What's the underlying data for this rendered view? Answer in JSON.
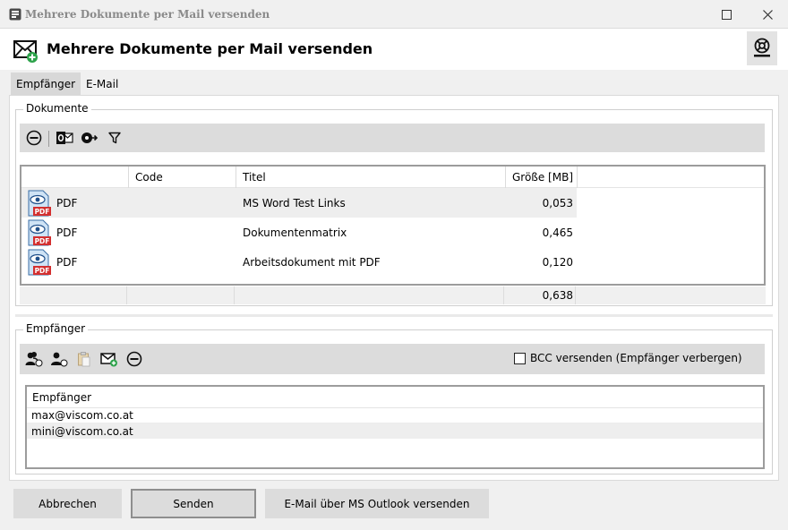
{
  "window": {
    "title": "Mehrere Dokumente per Mail versenden"
  },
  "header": {
    "title": "Mehrere Dokumente per Mail versenden"
  },
  "tabs": [
    {
      "label": "Empfänger",
      "active": true
    },
    {
      "label": "E-Mail",
      "active": false
    }
  ],
  "documents": {
    "legend": "Dokumente",
    "toolbar_icons": [
      "remove-icon",
      "outlook-icon",
      "export-icon",
      "filter-icon"
    ],
    "columns": [
      "Code",
      "Titel",
      "Größe [MB]"
    ],
    "rows": [
      {
        "type": "PDF",
        "code": "",
        "title": "MS Word Test Links",
        "size": "0,053",
        "selected": true
      },
      {
        "type": "PDF",
        "code": "",
        "title": "Dokumentenmatrix",
        "size": "0,465",
        "selected": false
      },
      {
        "type": "PDF",
        "code": "",
        "title": "Arbeitsdokument mit PDF",
        "size": "0,120",
        "selected": false
      }
    ],
    "total_size": "0,638"
  },
  "recipients": {
    "legend": "Empfänger",
    "toolbar_icons": [
      "add-contacts-icon",
      "add-user-icon",
      "paste-icon",
      "add-mail-icon",
      "remove-icon"
    ],
    "bcc_label": "BCC versenden (Empfänger verbergen)",
    "bcc_checked": false,
    "column": "Empfänger",
    "rows": [
      "max@viscom.co.at",
      "mini@viscom.co.at"
    ]
  },
  "buttons": {
    "cancel": "Abbrechen",
    "send": "Senden",
    "outlook": "E-Mail über MS Outlook versenden"
  },
  "colors": {
    "toolbar": "#dcdcdc",
    "selected_row": "#eeeeee",
    "tab_active": "#d8d8d8",
    "mail_badge": "#2ca24a"
  }
}
